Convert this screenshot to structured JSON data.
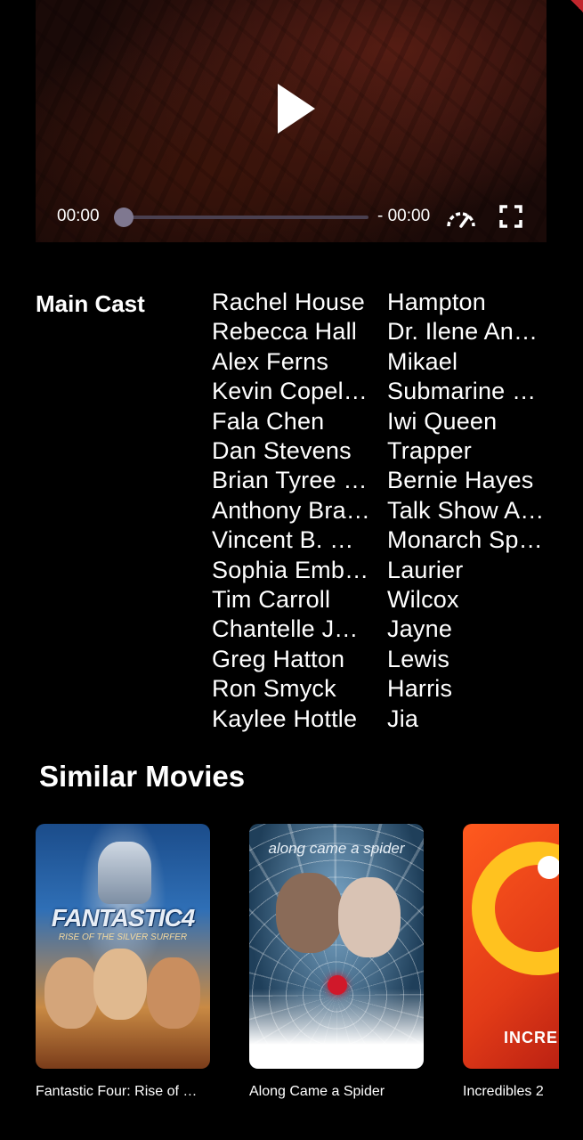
{
  "player": {
    "current_time": "00:00",
    "remaining_time": "- 00:00",
    "progress": 0
  },
  "cast": {
    "heading": "Main Cast",
    "members": [
      {
        "actor": "Rachel House",
        "role": "Hampton"
      },
      {
        "actor": "Rebecca Hall",
        "role": "Dr. Ilene And…"
      },
      {
        "actor": "Alex Ferns",
        "role": "Mikael"
      },
      {
        "actor": "Kevin Copel…",
        "role": "Submarine …"
      },
      {
        "actor": "Fala Chen",
        "role": "Iwi Queen"
      },
      {
        "actor": "Dan Stevens",
        "role": "Trapper"
      },
      {
        "actor": "Brian Tyree …",
        "role": "Bernie Hayes"
      },
      {
        "actor": "Anthony Bra…",
        "role": "Talk Show A…"
      },
      {
        "actor": "Vincent B. G…",
        "role": "Monarch Sp…"
      },
      {
        "actor": "Sophia Emb…",
        "role": "Laurier"
      },
      {
        "actor": "Tim Carroll",
        "role": "Wilcox"
      },
      {
        "actor": "Chantelle Ja…",
        "role": "Jayne"
      },
      {
        "actor": "Greg Hatton",
        "role": "Lewis"
      },
      {
        "actor": "Ron Smyck",
        "role": "Harris"
      },
      {
        "actor": "Kaylee Hottle",
        "role": "Jia"
      }
    ]
  },
  "similar": {
    "heading": "Similar Movies",
    "movies": [
      {
        "title": "Fantastic Four: Rise of …",
        "poster_text": "FANTASTIC4",
        "poster_subtext": "RISE OF THE SILVER SURFER"
      },
      {
        "title": "Along Came a Spider",
        "poster_text": "along came a spider"
      },
      {
        "title": "Incredibles 2",
        "poster_text": "INCREDIB"
      }
    ]
  },
  "colors": {
    "background": "#000000",
    "accent": "#c0262d",
    "seek_track": "#4a4050",
    "seek_thumb": "#7f7890"
  }
}
